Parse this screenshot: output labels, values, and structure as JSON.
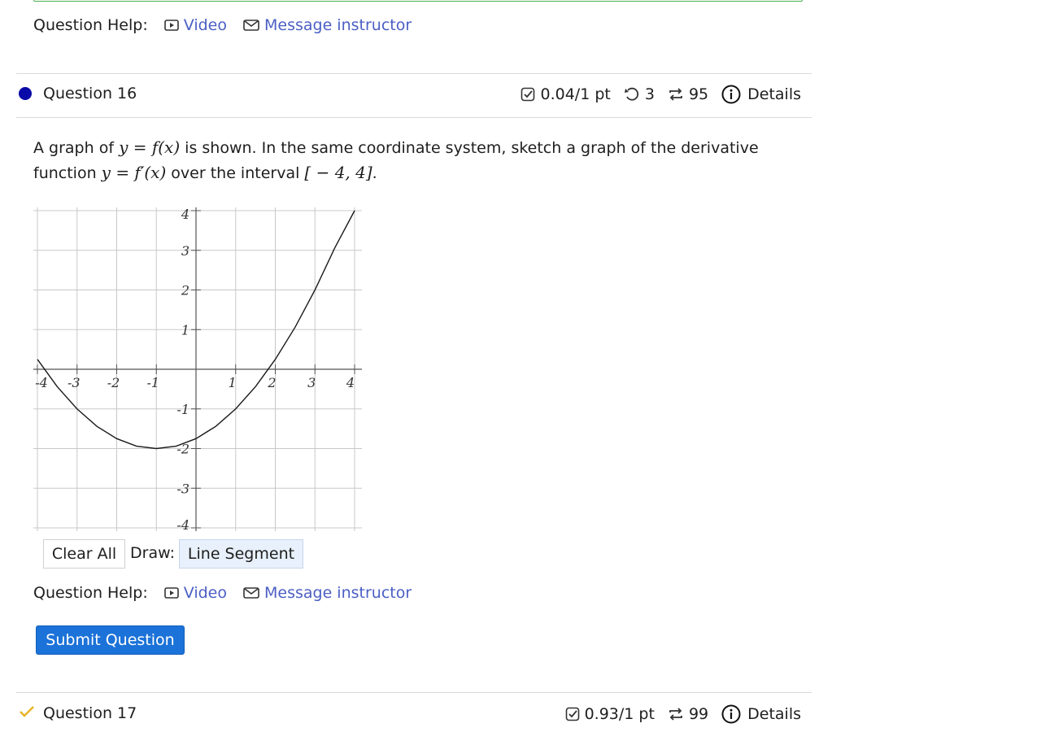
{
  "help": {
    "label": "Question Help:",
    "video": "Video",
    "message": "Message instructor"
  },
  "q16": {
    "title": "Question 16",
    "score": "0.04/1 pt",
    "retries": "3",
    "attempts": "95",
    "details": "Details",
    "prompt": {
      "p1": "A graph of ",
      "m1": "y = f(x)",
      "p2": " is shown. In the same coordinate system, sketch a graph of the derivative",
      "p3": "function ",
      "m2": "y = f′(x)",
      "p4": " over the interval ",
      "m3": "[ − 4, 4]",
      "p5": "."
    },
    "graph": {
      "x_ticks": [
        "-4",
        "-3",
        "-2",
        "-1",
        "1",
        "2",
        "3",
        "4"
      ],
      "y_ticks": [
        "4",
        "3",
        "2",
        "1",
        "-1",
        "-2",
        "-3",
        "-4"
      ]
    },
    "controls": {
      "clear": "Clear All",
      "draw_label": "Draw:",
      "tool": "Line Segment"
    },
    "submit": "Submit Question"
  },
  "q17": {
    "title": "Question 17",
    "score": "0.93/1 pt",
    "attempts": "99",
    "details": "Details"
  },
  "chart_data": {
    "type": "line",
    "title": "",
    "xlabel": "",
    "ylabel": "",
    "xlim": [
      -4,
      4
    ],
    "ylim": [
      -4,
      4
    ],
    "grid": true,
    "series": [
      {
        "x": [
          -4,
          -3.5,
          -3,
          -2.5,
          -2,
          -1.5,
          -1,
          -0.5,
          0,
          0.5,
          1,
          1.5,
          2,
          2.5,
          3,
          3.5,
          4
        ],
        "y": [
          0.25,
          -0.44,
          -1.0,
          -1.44,
          -1.75,
          -1.94,
          -2.0,
          -1.94,
          -1.75,
          -1.44,
          -1.0,
          -0.44,
          0.25,
          1.06,
          2.0,
          3.06,
          4.0
        ]
      }
    ]
  }
}
